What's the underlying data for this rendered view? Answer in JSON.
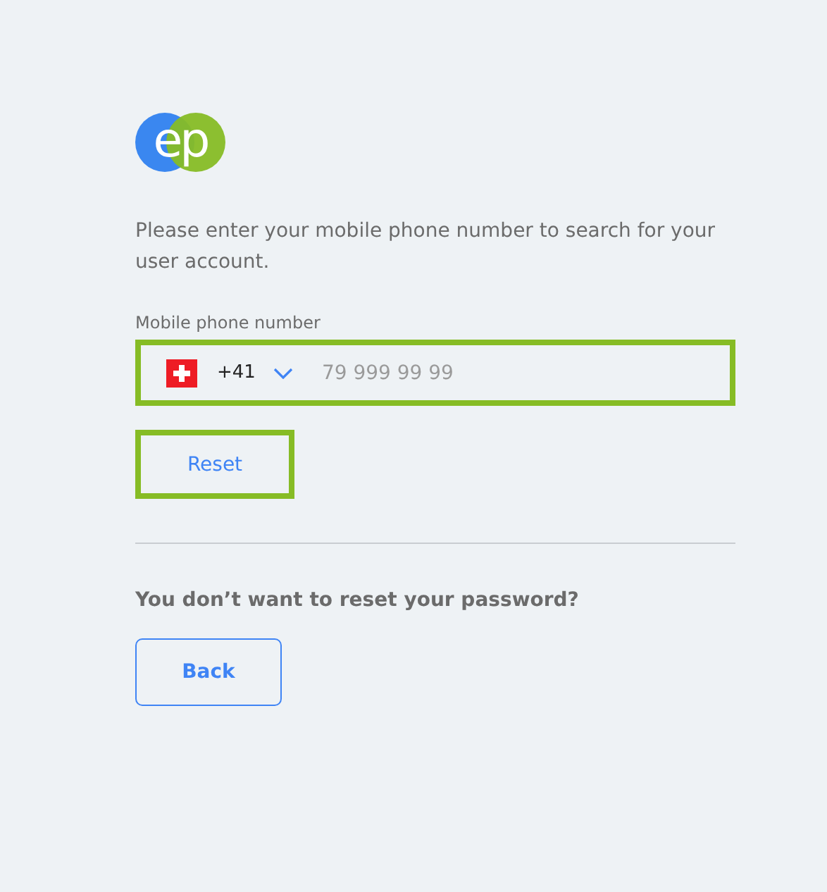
{
  "logo": {
    "text": "ep"
  },
  "intro": "Please enter your mobile phone number to search for your user account.",
  "phone": {
    "label": "Mobile phone number",
    "country_code": "+41",
    "placeholder": "79 999 99 99",
    "highlighted": true
  },
  "reset_button": {
    "label": "Reset",
    "highlighted": true
  },
  "question": "You don’t want to reset your password?",
  "back_button": {
    "label": "Back"
  }
}
